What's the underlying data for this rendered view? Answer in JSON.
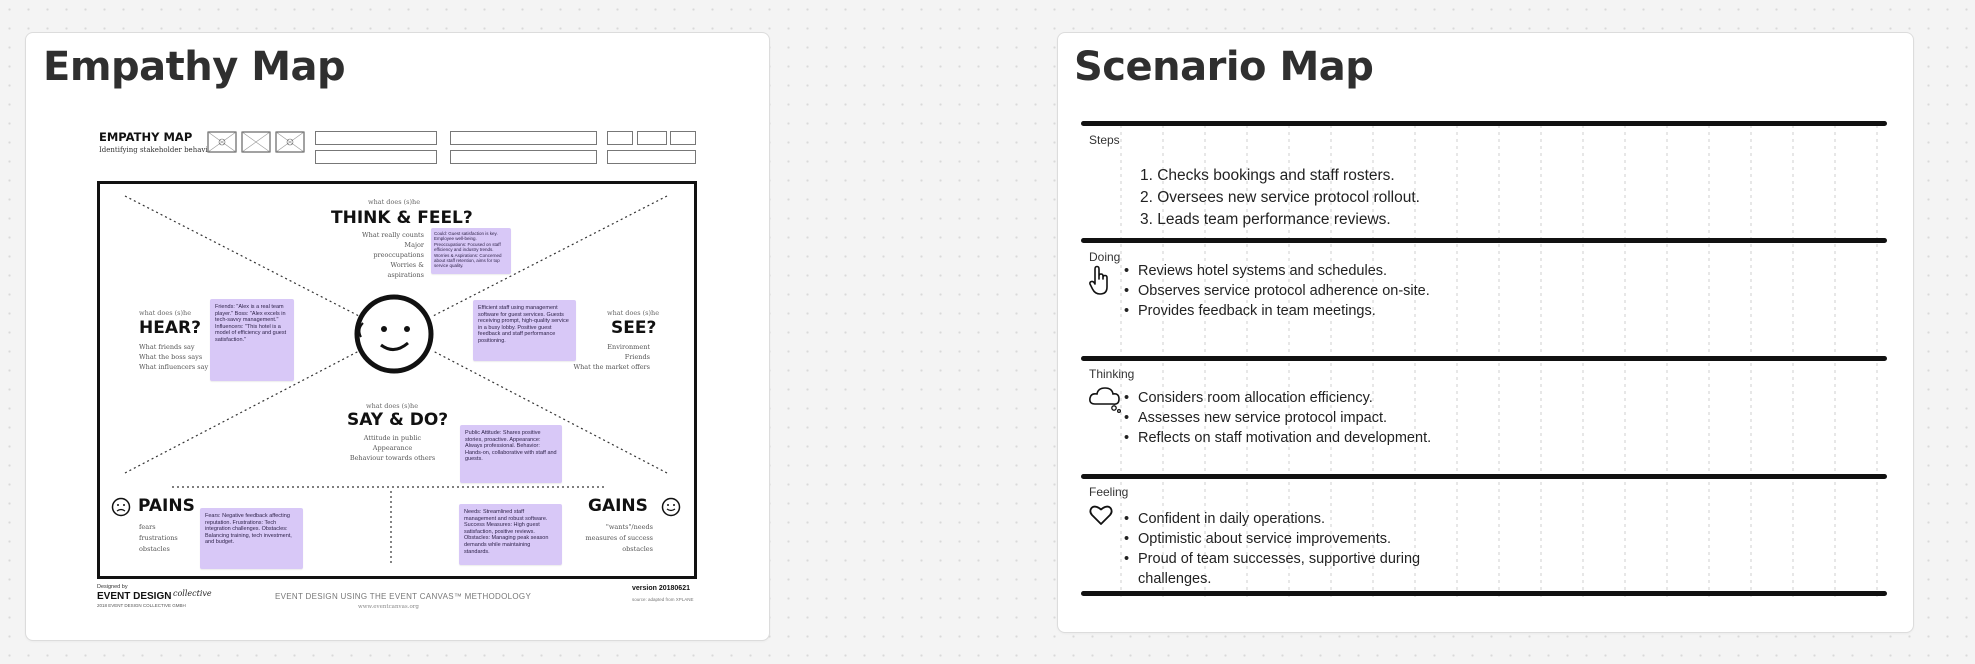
{
  "empathy_frame": {
    "title": "Empathy Map",
    "sheet": {
      "header_title": "EMPATHY MAP",
      "header_subtitle": "Identifying stakeholder behaviour",
      "think": {
        "small": "what does (s)he",
        "title": "THINK & FEEL?",
        "lines": [
          "What really counts",
          "Major preoccupations",
          "Worries & aspirations"
        ],
        "sticky": "Could: Guest satisfaction is key. Employee well-being. Preoccupations: Focused on staff efficiency and industry trends. Worries & Aspirations: Concerned about staff retention, aims for top service quality."
      },
      "hear": {
        "small": "what does (s)he",
        "title": "HEAR?",
        "lines": [
          "What friends say",
          "What the boss says",
          "What influencers say"
        ],
        "sticky": "Friends: \"Alex is a real team player.\" Boss: \"Alex excels in tech-savvy management.\" Influencers: \"This hotel is a model of efficiency and guest satisfaction.\""
      },
      "see": {
        "small": "what does (s)he",
        "title": "SEE?",
        "lines": [
          "Environment",
          "Friends",
          "What the market offers"
        ],
        "sticky": "Efficient staff using management software for guest services. Guests receiving prompt, high-quality service in a busy lobby. Positive guest feedback and staff performance positioning."
      },
      "say": {
        "small": "what does (s)he",
        "title": "SAY & DO?",
        "lines": [
          "Attitude in public",
          "Appearance",
          "Behaviour towards others"
        ],
        "sticky": "Public Attitude: Shares positive stories, proactive. Appearance: Always professional. Behavior: Hands-on, collaborative with staff and guests."
      },
      "pains": {
        "title": "PAINS",
        "lines": [
          "fears",
          "frustrations",
          "obstacles"
        ],
        "sticky": "Fears: Negative feedback affecting reputation. Frustrations: Tech integration challenges. Obstacles: Balancing training, tech investment, and budget."
      },
      "gains": {
        "title": "GAINS",
        "lines": [
          "\"wants\"/needs",
          "measures of success",
          "obstacles"
        ],
        "sticky": "Needs: Streamlined staff management and robust software. Success Measures: High guest satisfaction, positive reviews. Obstacles: Managing peak season demands while maintaining standards."
      },
      "footer": {
        "designed_by": "Designed by",
        "brand": "EVENT DESIGN",
        "brand_script": "collective",
        "copyright": "2018 EVENT DESIGN COLLECTIVE GMBH",
        "center": "EVENT DESIGN USING THE EVENT CANVAS™ METHODOLOGY",
        "url": "www.eventcanvas.org",
        "version": "version 20180621",
        "source": "source: adapted from XPLANE"
      }
    }
  },
  "scenario_frame": {
    "title": "Scenario Map",
    "rows": [
      {
        "label": "Steps",
        "icon": "numbered-list",
        "items": [
          "1. Checks bookings and staff rosters.",
          "2. Oversees new service protocol rollout.",
          "3. Leads team performance reviews."
        ]
      },
      {
        "label": "Doing",
        "icon": "hand-pointer-icon",
        "items": [
          "Reviews hotel systems and schedules.",
          "Observes service protocol adherence on-site.",
          "Provides feedback in team meetings."
        ]
      },
      {
        "label": "Thinking",
        "icon": "thought-cloud-icon",
        "items": [
          "Considers room allocation efficiency.",
          "Assesses new service protocol impact.",
          "Reflects on staff motivation and development."
        ]
      },
      {
        "label": "Feeling",
        "icon": "heart-icon",
        "items": [
          "Confident in daily operations.",
          "Optimistic about service improvements.",
          "Proud of team successes, supportive during challenges."
        ]
      }
    ]
  },
  "colors": {
    "sticky": "#d8c8f7",
    "rule": "#111111",
    "canvas": "#f4f4f4"
  }
}
